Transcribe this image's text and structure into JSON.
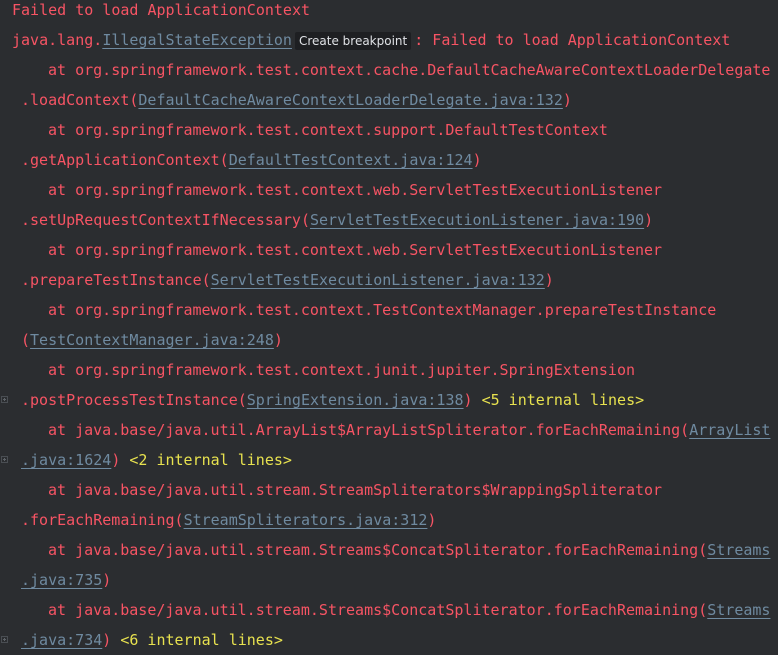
{
  "colors": {
    "background": "#2b2d30",
    "error": "#f75464",
    "link": "#6f8aa0",
    "internal": "#e8e24f"
  },
  "lines": [
    {
      "indent": 0,
      "segs": [
        {
          "k": "t",
          "v": "Failed to load ApplicationContext"
        }
      ]
    },
    {
      "indent": 0,
      "segs": [
        {
          "k": "t",
          "v": "java.lang."
        },
        {
          "k": "l",
          "v": "IllegalStateException"
        },
        {
          "k": "b",
          "v": "Create breakpoint"
        },
        {
          "k": "t",
          "v": ": Failed to load ApplicationContext"
        }
      ]
    },
    {
      "indent": 1,
      "segs": [
        {
          "k": "t",
          "v": "at org.springframework.test.context.cache.DefaultCacheAwareContextLoaderDelegate"
        }
      ]
    },
    {
      "indent": 2,
      "segs": [
        {
          "k": "t",
          "v": ".loadContext("
        },
        {
          "k": "l",
          "v": "DefaultCacheAwareContextLoaderDelegate.java:132"
        },
        {
          "k": "t",
          "v": ")"
        }
      ]
    },
    {
      "indent": 1,
      "segs": [
        {
          "k": "t",
          "v": "at org.springframework.test.context.support.DefaultTestContext"
        }
      ]
    },
    {
      "indent": 2,
      "segs": [
        {
          "k": "t",
          "v": ".getApplicationContext("
        },
        {
          "k": "l",
          "v": "DefaultTestContext.java:124"
        },
        {
          "k": "t",
          "v": ")"
        }
      ]
    },
    {
      "indent": 1,
      "segs": [
        {
          "k": "t",
          "v": "at org.springframework.test.context.web.ServletTestExecutionListener"
        }
      ]
    },
    {
      "indent": 2,
      "segs": [
        {
          "k": "t",
          "v": ".setUpRequestContextIfNecessary("
        },
        {
          "k": "l",
          "v": "ServletTestExecutionListener.java:190"
        },
        {
          "k": "t",
          "v": ")"
        }
      ]
    },
    {
      "indent": 1,
      "segs": [
        {
          "k": "t",
          "v": "at org.springframework.test.context.web.ServletTestExecutionListener"
        }
      ]
    },
    {
      "indent": 2,
      "segs": [
        {
          "k": "t",
          "v": ".prepareTestInstance("
        },
        {
          "k": "l",
          "v": "ServletTestExecutionListener.java:132"
        },
        {
          "k": "t",
          "v": ")"
        }
      ]
    },
    {
      "indent": 1,
      "segs": [
        {
          "k": "t",
          "v": "at org.springframework.test.context.TestContextManager.prepareTestInstance"
        }
      ]
    },
    {
      "indent": 2,
      "segs": [
        {
          "k": "t",
          "v": "("
        },
        {
          "k": "l",
          "v": "TestContextManager.java:248"
        },
        {
          "k": "t",
          "v": ")"
        }
      ]
    },
    {
      "indent": 1,
      "segs": [
        {
          "k": "t",
          "v": "at org.springframework.test.context.junit.jupiter.SpringExtension"
        }
      ]
    },
    {
      "indent": 2,
      "fold": true,
      "segs": [
        {
          "k": "t",
          "v": ".postProcessTestInstance("
        },
        {
          "k": "l",
          "v": "SpringExtension.java:138"
        },
        {
          "k": "t",
          "v": ") "
        },
        {
          "k": "i",
          "v": "<5 internal lines>"
        }
      ]
    },
    {
      "indent": 1,
      "segs": [
        {
          "k": "t",
          "v": "at java.base/java.util.ArrayList$ArrayListSpliterator.forEachRemaining("
        },
        {
          "k": "l",
          "v": "ArrayList"
        }
      ]
    },
    {
      "indent": 2,
      "fold": true,
      "segs": [
        {
          "k": "l",
          "v": ".java:1624"
        },
        {
          "k": "t",
          "v": ") "
        },
        {
          "k": "i",
          "v": "<2 internal lines>"
        }
      ]
    },
    {
      "indent": 1,
      "segs": [
        {
          "k": "t",
          "v": "at java.base/java.util.stream.StreamSpliterators$WrappingSpliterator"
        }
      ]
    },
    {
      "indent": 2,
      "segs": [
        {
          "k": "t",
          "v": ".forEachRemaining("
        },
        {
          "k": "l",
          "v": "StreamSpliterators.java:312"
        },
        {
          "k": "t",
          "v": ")"
        }
      ]
    },
    {
      "indent": 1,
      "segs": [
        {
          "k": "t",
          "v": "at java.base/java.util.stream.Streams$ConcatSpliterator.forEachRemaining("
        },
        {
          "k": "l",
          "v": "Streams"
        }
      ]
    },
    {
      "indent": 2,
      "segs": [
        {
          "k": "l",
          "v": ".java:735"
        },
        {
          "k": "t",
          "v": ")"
        }
      ]
    },
    {
      "indent": 1,
      "segs": [
        {
          "k": "t",
          "v": "at java.base/java.util.stream.Streams$ConcatSpliterator.forEachRemaining("
        },
        {
          "k": "l",
          "v": "Streams"
        }
      ]
    },
    {
      "indent": 2,
      "fold": true,
      "segs": [
        {
          "k": "l",
          "v": ".java:734"
        },
        {
          "k": "t",
          "v": ") "
        },
        {
          "k": "i",
          "v": "<6 internal lines>"
        }
      ]
    }
  ]
}
